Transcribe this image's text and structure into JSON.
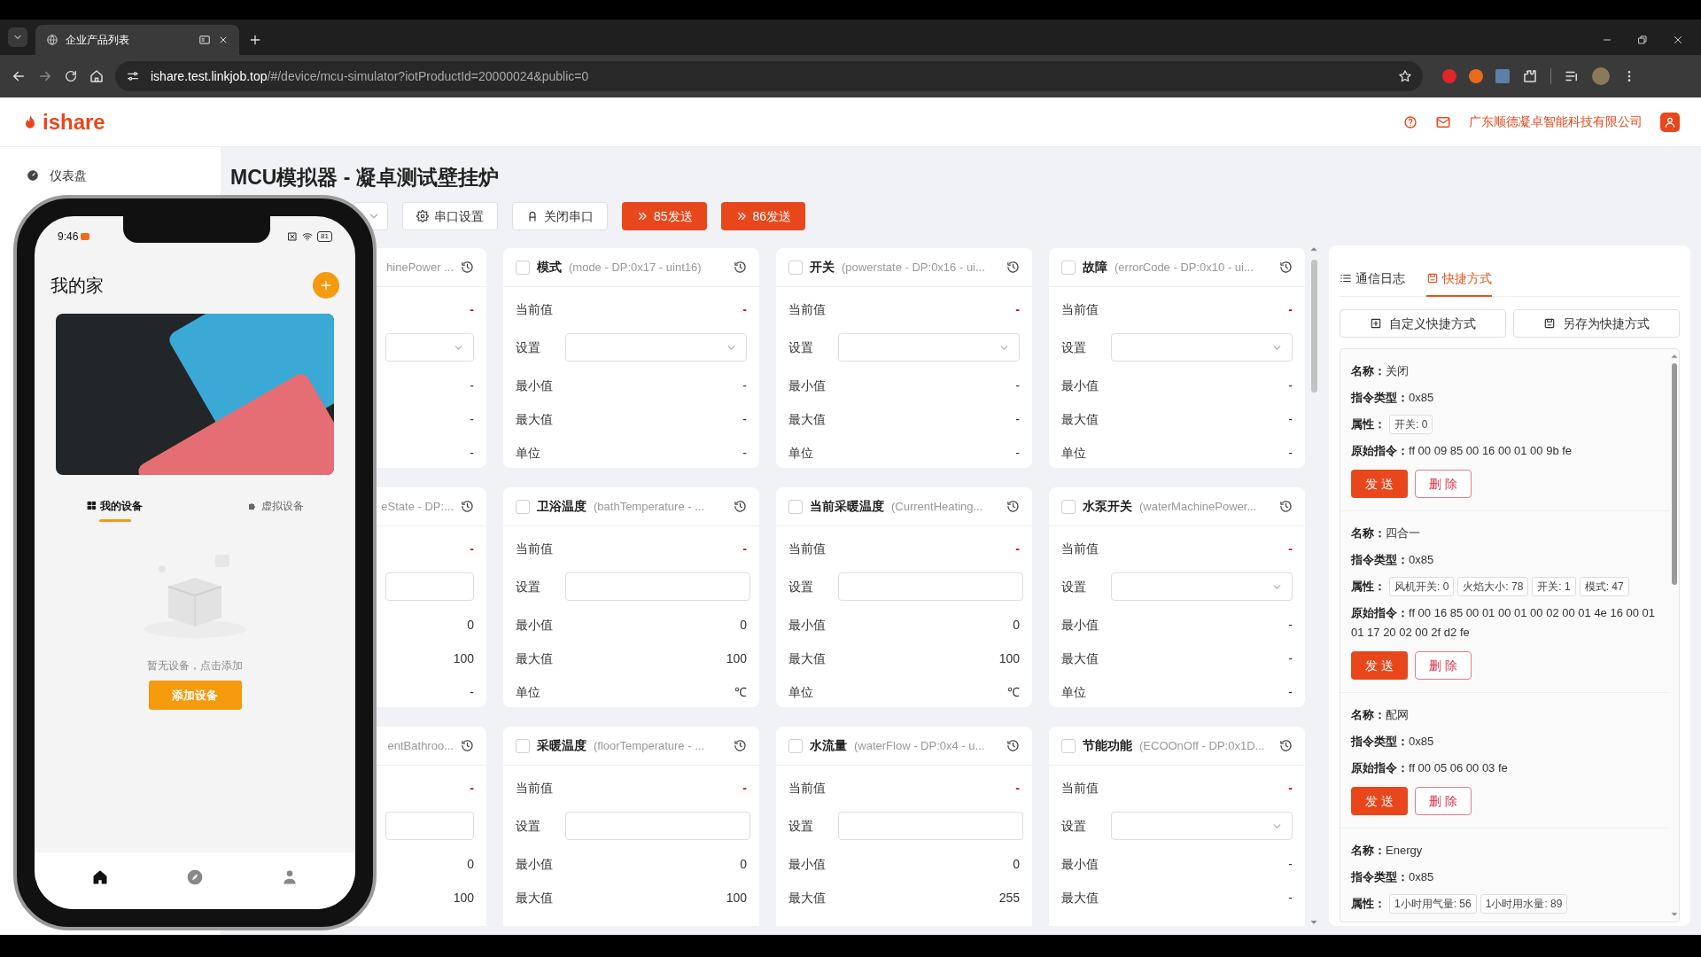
{
  "browser": {
    "tab": {
      "title": "企业产品列表",
      "selected": true
    },
    "url": {
      "host": "ishare.test.linkjob.top",
      "path": "/#/device/mcu-simulator?iotProductId=20000024&public=0"
    }
  },
  "header": {
    "logo": "ishare",
    "company": "广东顺德凝卓智能科技有限公司"
  },
  "sidebar": {
    "items": [
      {
        "label": "仪表盘"
      }
    ]
  },
  "page": {
    "title": "MCU模拟器 - 凝卓测试壁挂炉"
  },
  "toolbar": [
    {
      "kind": "select"
    },
    {
      "kind": "settings",
      "label": "串口设置"
    },
    {
      "kind": "close",
      "label": "关闭串口"
    },
    {
      "kind": "send",
      "label": "85发送"
    },
    {
      "kind": "send",
      "label": "86发送"
    }
  ],
  "cards": [
    {
      "code": "hinePower ...",
      "rows": [
        {
          "kind": "current",
          "value": "-"
        },
        {
          "kind": "select"
        },
        {
          "kind": "value",
          "value": "-"
        },
        {
          "kind": "value",
          "value": "-"
        },
        {
          "kind": "value",
          "value": "-"
        }
      ]
    },
    {
      "name": "模式",
      "code": "(mode - DP:0x17 - uint16)",
      "checked": false,
      "rows": [
        {
          "kind": "current",
          "label": "当前值",
          "value": "-"
        },
        {
          "kind": "select",
          "label": "设置"
        },
        {
          "kind": "value",
          "label": "最小值",
          "value": "-"
        },
        {
          "kind": "value",
          "label": "最大值",
          "value": "-"
        },
        {
          "kind": "value",
          "label": "单位",
          "value": "-"
        }
      ]
    },
    {
      "name": "开关",
      "code": "(powerstate - DP:0x16 - ui...",
      "checked": false,
      "rows": [
        {
          "kind": "current",
          "label": "当前值",
          "value": "-"
        },
        {
          "kind": "select",
          "label": "设置"
        },
        {
          "kind": "value",
          "label": "最小值",
          "value": "-"
        },
        {
          "kind": "value",
          "label": "最大值",
          "value": "-"
        },
        {
          "kind": "value",
          "label": "单位",
          "value": "-"
        }
      ]
    },
    {
      "name": "故障",
      "code": "(errorCode - DP:0x10 - ui...",
      "checked": false,
      "rows": [
        {
          "kind": "current",
          "label": "当前值",
          "value": "-"
        },
        {
          "kind": "select",
          "label": "设置"
        },
        {
          "kind": "value",
          "label": "最小值",
          "value": "-"
        },
        {
          "kind": "value",
          "label": "最大值",
          "value": "-"
        },
        {
          "kind": "value",
          "label": "单位",
          "value": "-"
        }
      ]
    },
    {
      "code": "eState - DP:...",
      "rows": [
        {
          "kind": "current",
          "value": "-"
        },
        {
          "kind": "input"
        },
        {
          "kind": "value",
          "value": "0"
        },
        {
          "kind": "value",
          "value": "100"
        },
        {
          "kind": "value",
          "value": "-"
        }
      ]
    },
    {
      "name": "卫浴温度",
      "code": "(bathTemperature - ...",
      "checked": false,
      "rows": [
        {
          "kind": "current",
          "label": "当前值",
          "value": "-"
        },
        {
          "kind": "input",
          "label": "设置"
        },
        {
          "kind": "value",
          "label": "最小值",
          "value": "0"
        },
        {
          "kind": "value",
          "label": "最大值",
          "value": "100"
        },
        {
          "kind": "value",
          "label": "单位",
          "value": "℃"
        }
      ]
    },
    {
      "name": "当前采暖温度",
      "code": "(CurrentHeating...",
      "checked": false,
      "rows": [
        {
          "kind": "current",
          "label": "当前值",
          "value": "-"
        },
        {
          "kind": "input",
          "label": "设置"
        },
        {
          "kind": "value",
          "label": "最小值",
          "value": "0"
        },
        {
          "kind": "value",
          "label": "最大值",
          "value": "100"
        },
        {
          "kind": "value",
          "label": "单位",
          "value": "℃"
        }
      ]
    },
    {
      "name": "水泵开关",
      "code": "(waterMachinePower...",
      "checked": false,
      "rows": [
        {
          "kind": "current",
          "label": "当前值",
          "value": "-"
        },
        {
          "kind": "select",
          "label": "设置"
        },
        {
          "kind": "value",
          "label": "最小值",
          "value": "-"
        },
        {
          "kind": "value",
          "label": "最大值",
          "value": "-"
        },
        {
          "kind": "value",
          "label": "单位",
          "value": "-"
        }
      ]
    },
    {
      "code": "entBathroo...",
      "rows": [
        {
          "kind": "current",
          "value": "-"
        },
        {
          "kind": "input"
        },
        {
          "kind": "value",
          "value": "0"
        },
        {
          "kind": "value",
          "value": "100"
        }
      ]
    },
    {
      "name": "采暖温度",
      "code": "(floorTemperature - ...",
      "checked": false,
      "rows": [
        {
          "kind": "current",
          "label": "当前值",
          "value": "-"
        },
        {
          "kind": "input",
          "label": "设置"
        },
        {
          "kind": "value",
          "label": "最小值",
          "value": "0"
        },
        {
          "kind": "value",
          "label": "最大值",
          "value": "100"
        }
      ]
    },
    {
      "name": "水流量",
      "code": "(waterFlow - DP:0x4 - u...",
      "checked": false,
      "rows": [
        {
          "kind": "current",
          "label": "当前值",
          "value": "-"
        },
        {
          "kind": "input",
          "label": "设置"
        },
        {
          "kind": "value",
          "label": "最小值",
          "value": "0"
        },
        {
          "kind": "value",
          "label": "最大值",
          "value": "255"
        }
      ]
    },
    {
      "name": "节能功能",
      "code": "(ECOOnOff - DP:0x1D...",
      "checked": false,
      "rows": [
        {
          "kind": "current",
          "label": "当前值",
          "value": "-"
        },
        {
          "kind": "select",
          "label": "设置"
        },
        {
          "kind": "value",
          "label": "最小值",
          "value": "-"
        },
        {
          "kind": "value",
          "label": "最大值",
          "value": "-"
        }
      ]
    }
  ],
  "panel": {
    "tabs": [
      {
        "kind": "log",
        "label": "通信日志",
        "selected": false
      },
      {
        "kind": "shortcut",
        "label": "快捷方式",
        "selected": true
      }
    ],
    "actions": [
      {
        "kind": "add",
        "label": "自定义快捷方式"
      },
      {
        "kind": "save",
        "label": "另存为快捷方式"
      }
    ],
    "shortcuts": [
      {
        "rows": [
          {
            "kind": "text",
            "label": "名称：",
            "value": "关闭"
          },
          {
            "kind": "text",
            "label": "指令类型：",
            "value": "0x85"
          },
          {
            "kind": "tags",
            "label": "属性：",
            "tags": [
              "开关: 0"
            ]
          },
          {
            "kind": "text",
            "label": "原始指令：",
            "value": "ff 00 09 85 00 16 00 01 00 9b fe"
          }
        ],
        "buttons": [
          {
            "kind": "primary",
            "label": "发 送"
          },
          {
            "kind": "danger",
            "label": "删 除"
          }
        ]
      },
      {
        "rows": [
          {
            "kind": "text",
            "label": "名称：",
            "value": "四合一"
          },
          {
            "kind": "text",
            "label": "指令类型：",
            "value": "0x85"
          },
          {
            "kind": "tags",
            "label": "属性：",
            "tags": [
              "风机开关: 0",
              "火焰大小: 78",
              "开关: 1",
              "模式: 47"
            ]
          },
          {
            "kind": "text",
            "label": "原始指令：",
            "value": "ff 00 16 85 00 01 00 01 00 02 00 01 4e 16 00 01 01 17 20 02 00 2f d2 fe"
          }
        ],
        "buttons": [
          {
            "kind": "primary",
            "label": "发 送"
          },
          {
            "kind": "danger",
            "label": "删 除"
          }
        ]
      },
      {
        "rows": [
          {
            "kind": "text",
            "label": "名称：",
            "value": "配网"
          },
          {
            "kind": "text",
            "label": "指令类型：",
            "value": "0x85"
          },
          {
            "kind": "text",
            "label": "原始指令：",
            "value": "ff 00 05 06 00 03 fe"
          }
        ],
        "buttons": [
          {
            "kind": "primary",
            "label": "发 送"
          },
          {
            "kind": "danger",
            "label": "删 除"
          }
        ]
      },
      {
        "rows": [
          {
            "kind": "text",
            "label": "名称：",
            "value": "Energy"
          },
          {
            "kind": "text",
            "label": "指令类型：",
            "value": "0x85"
          },
          {
            "kind": "tags",
            "label": "属性：",
            "tags": [
              "1小时用气量: 56",
              "1小时用水量: 89"
            ]
          }
        ]
      }
    ]
  },
  "phone": {
    "time": "9:46",
    "battery": "81",
    "title": "我的家",
    "tabs": [
      {
        "label": "我的设备",
        "selected": true
      },
      {
        "label": "虚拟设备",
        "selected": false
      }
    ],
    "empty_text": "暂无设备，点击添加",
    "add_button": "添加设备",
    "nav": [
      {
        "kind": "home",
        "selected": true
      },
      {
        "kind": "discover",
        "selected": false
      },
      {
        "kind": "profile",
        "selected": false
      }
    ]
  }
}
